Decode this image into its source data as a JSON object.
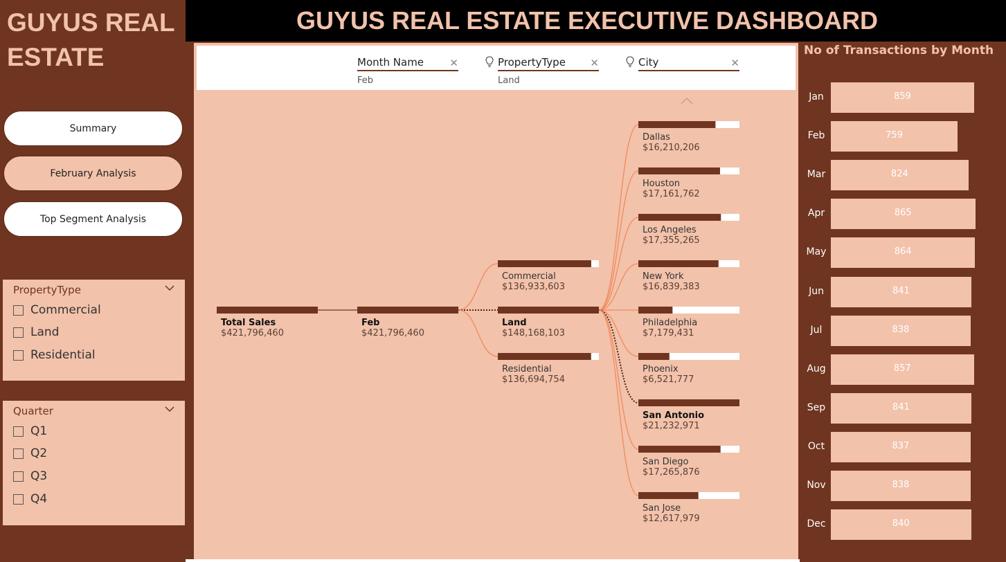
{
  "brand": {
    "title": "GUYUS REAL ESTATE"
  },
  "header": {
    "title": "GUYUS REAL ESTATE EXECUTIVE DASHBOARD"
  },
  "nav": {
    "summary": "Summary",
    "february_analysis": "February Analysis",
    "top_segment_analysis": "Top Segment Analysis"
  },
  "slicers": {
    "property_type": {
      "title": "PropertyType",
      "options": [
        "Commercial",
        "Land",
        "Residential"
      ]
    },
    "quarter": {
      "title": "Quarter",
      "options": [
        "Q1",
        "Q2",
        "Q3",
        "Q4"
      ]
    }
  },
  "filters": [
    {
      "name": "Month Name",
      "value": "Feb"
    },
    {
      "name": "PropertyType",
      "value": "Land"
    },
    {
      "name": "City",
      "value": ""
    }
  ],
  "colors": {
    "brown": "#6f3520",
    "pink": "#f2c2ab",
    "white": "#ffffff",
    "link": "#f08a5d",
    "black": "#000000"
  },
  "chart_data": [
    {
      "type": "decomposition-tree",
      "levels": [
        {
          "name": "Total Sales",
          "nodes": [
            {
              "label": "Total Sales",
              "value": 421796460,
              "display": "$421,796,460",
              "share": 1.0,
              "selected": true
            }
          ]
        },
        {
          "name": "Month Name",
          "nodes": [
            {
              "label": "Feb",
              "value": 421796460,
              "display": "$421,796,460",
              "share": 1.0,
              "selected": true
            }
          ]
        },
        {
          "name": "PropertyType",
          "nodes": [
            {
              "label": "Commercial",
              "value": 136933603,
              "display": "$136,933,603",
              "share": 0.924,
              "selected": false
            },
            {
              "label": "Land",
              "value": 148168103,
              "display": "$148,168,103",
              "share": 1.0,
              "selected": true
            },
            {
              "label": "Residential",
              "value": 136694754,
              "display": "$136,694,754",
              "share": 0.923,
              "selected": false
            }
          ]
        },
        {
          "name": "City",
          "nodes": [
            {
              "label": "Dallas",
              "value": 16210206,
              "display": "$16,210,206",
              "share": 0.763,
              "selected": false
            },
            {
              "label": "Houston",
              "value": 17161762,
              "display": "$17,161,762",
              "share": 0.808,
              "selected": false
            },
            {
              "label": "Los Angeles",
              "value": 17355265,
              "display": "$17,355,265",
              "share": 0.817,
              "selected": false
            },
            {
              "label": "New York",
              "value": 16839383,
              "display": "$16,839,383",
              "share": 0.793,
              "selected": false
            },
            {
              "label": "Philadelphia",
              "value": 7179431,
              "display": "$7,179,431",
              "share": 0.338,
              "selected": false
            },
            {
              "label": "Phoenix",
              "value": 6521777,
              "display": "$6,521,777",
              "share": 0.307,
              "selected": false
            },
            {
              "label": "San Antonio",
              "value": 21232971,
              "display": "$21,232,971",
              "share": 1.0,
              "selected": true
            },
            {
              "label": "San Diego",
              "value": 17265876,
              "display": "$17,265,876",
              "share": 0.813,
              "selected": false
            },
            {
              "label": "San Jose",
              "value": 12617979,
              "display": "$12,617,979",
              "share": 0.594,
              "selected": false
            }
          ]
        }
      ]
    },
    {
      "type": "bar",
      "orientation": "horizontal",
      "title": "No of Transactions by Month",
      "categories": [
        "Jan",
        "Feb",
        "Mar",
        "Apr",
        "May",
        "Jun",
        "Jul",
        "Aug",
        "Sep",
        "Oct",
        "Nov",
        "Dec"
      ],
      "values": [
        859,
        759,
        824,
        865,
        864,
        841,
        838,
        857,
        841,
        837,
        838,
        840
      ],
      "xlim": [
        0,
        900
      ]
    }
  ]
}
